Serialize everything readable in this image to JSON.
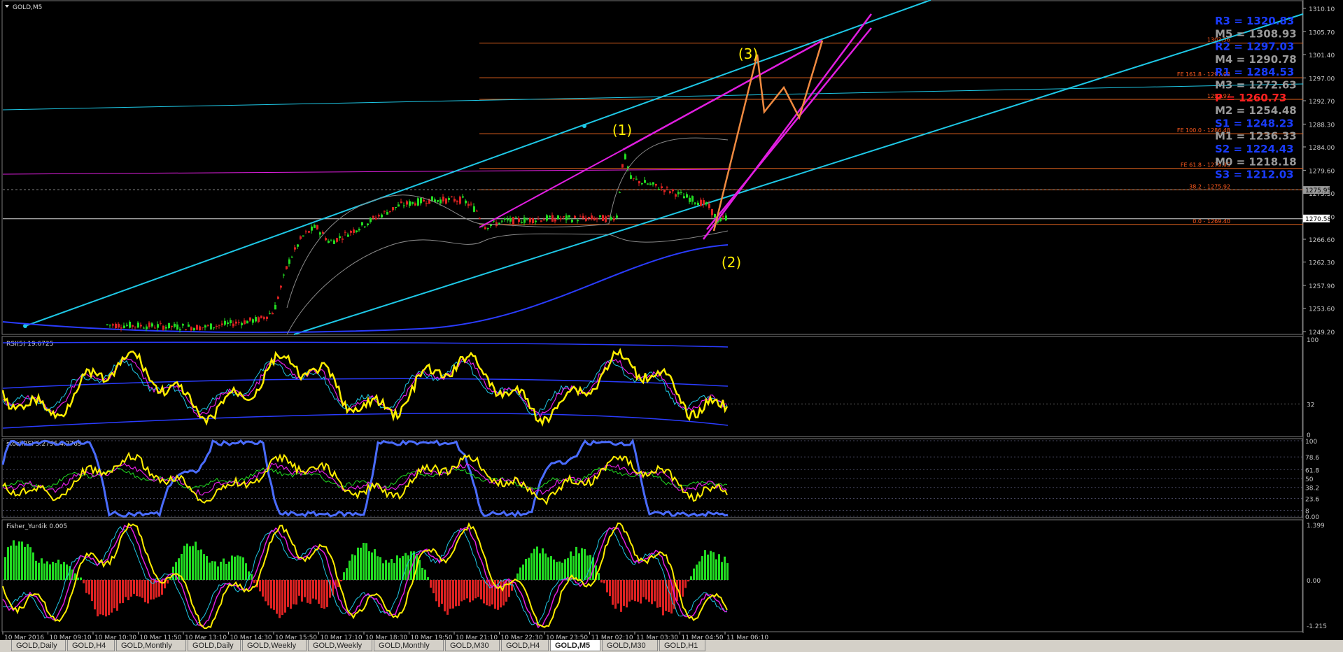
{
  "chart_data": [
    {
      "type": "candlestick",
      "title": "GOLD,M5",
      "price_axis_ticks": [
        "1310.10",
        "1305.70",
        "1301.40",
        "1297.00",
        "1292.70",
        "1288.30",
        "1284.00",
        "1279.60",
        "1275.30",
        "1270.90",
        "1266.60",
        "1262.30",
        "1257.90",
        "1253.60",
        "1249.20"
      ],
      "current_price": "1270.58",
      "dashed_price": "1275.95",
      "ylim": [
        1249.2,
        1310.1
      ],
      "pivot_levels": [
        {
          "name": "R3",
          "value": "1320.83",
          "color": "#1a3cff"
        },
        {
          "name": "M5",
          "value": "1308.93",
          "color": "#9a9a9a"
        },
        {
          "name": "R2",
          "value": "1297.03",
          "color": "#1a3cff"
        },
        {
          "name": "M4",
          "value": "1290.78",
          "color": "#9a9a9a"
        },
        {
          "name": "R1",
          "value": "1284.53",
          "color": "#1a3cff"
        },
        {
          "name": "M3",
          "value": "1272.63",
          "color": "#9a9a9a"
        },
        {
          "name": "P",
          "value": "1260.73",
          "color": "#ff2020"
        },
        {
          "name": "M2",
          "value": "1254.48",
          "color": "#9a9a9a"
        },
        {
          "name": "S1",
          "value": "1248.23",
          "color": "#1a3cff"
        },
        {
          "name": "M1",
          "value": "1236.33",
          "color": "#9a9a9a"
        },
        {
          "name": "S2",
          "value": "1224.43",
          "color": "#1a3cff"
        },
        {
          "name": "M0",
          "value": "1218.18",
          "color": "#9a9a9a"
        },
        {
          "name": "S3",
          "value": "1212.03",
          "color": "#1a3cff"
        }
      ],
      "fib_labels": [
        "1303.56",
        "FE 161.8 - 1297.03",
        "1292.97",
        "FE 100.0 - 1286.48",
        "FE 61.8 - 1279.95",
        "38.2 - 1275.92",
        "0.0 - 1269.40"
      ],
      "wave_labels": [
        "(1)",
        "(2)",
        "(3)"
      ]
    },
    {
      "type": "line",
      "title": "RSI(5) 19.6725",
      "ticks": [
        "100",
        "32",
        "0"
      ]
    },
    {
      "type": "line",
      "title": "stochRSI 5.2796 4.2769",
      "ticks": [
        "100",
        "78.6",
        "61.8",
        "50",
        "38.2",
        "23.6",
        "8",
        "0.00"
      ]
    },
    {
      "type": "bar",
      "title": "Fisher_Yur4ik 0.005",
      "ticks": [
        "1.399",
        "0.00",
        "-1.215"
      ]
    }
  ],
  "time_axis": [
    "10 Mar 2016",
    "10 Mar 09:10",
    "10 Mar 10:30",
    "10 Mar 11:50",
    "10 Mar 13:10",
    "10 Mar 14:30",
    "10 Mar 15:50",
    "10 Mar 17:10",
    "10 Mar 18:30",
    "10 Mar 19:50",
    "10 Mar 21:10",
    "10 Mar 22:30",
    "10 Mar 23:50",
    "11 Mar 02:10",
    "11 Mar 03:30",
    "11 Mar 04:50",
    "11 Mar 06:10"
  ],
  "tabs": [
    "GOLD,Daily",
    "GOLD,H4",
    "GOLD,Monthly",
    "GOLD,Daily",
    "GOLD,Weekly",
    "GOLD,Weekly",
    "GOLD,Monthly",
    "GOLD,M30",
    "GOLD,H4",
    "GOLD,M5",
    "GOLD,M30",
    "GOLD,H1"
  ],
  "active_tab": 9,
  "colors": {
    "cyan": "#1ec8e6",
    "magenta": "#e11ee1",
    "orange": "#f08a40",
    "hline": "#e0621e",
    "wave": "#ffee00",
    "rsi": "#ffee00",
    "up": "#22dd22",
    "down": "#dd2222"
  }
}
